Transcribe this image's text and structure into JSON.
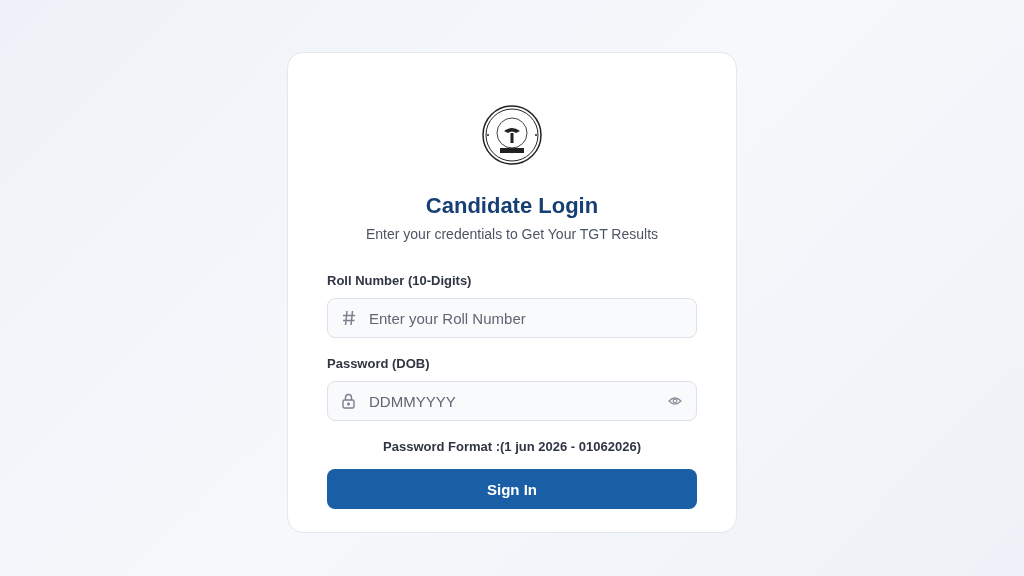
{
  "title": "Candidate Login",
  "subtitle": "Enter your credentials to Get Your TGT Results",
  "fields": [
    {
      "label": "Roll Number (10-Digits)",
      "placeholder": "Enter your Roll Number",
      "kind": "number"
    },
    {
      "label": "Password (DOB)",
      "placeholder": "DDMMYYYY",
      "kind": "password"
    }
  ],
  "hint": "Password Format :(1 jun 2026 - 01062026)",
  "button": "Sign In"
}
